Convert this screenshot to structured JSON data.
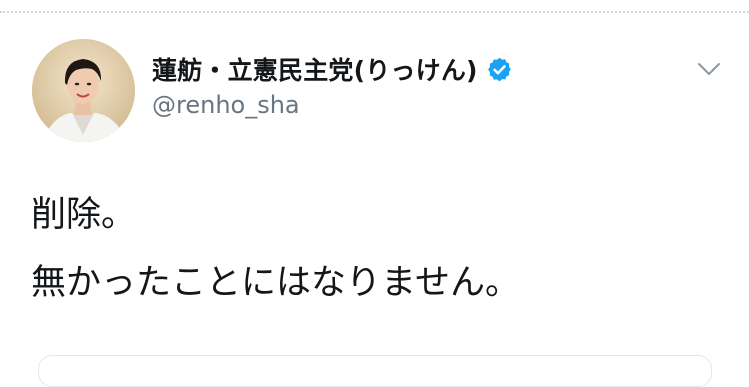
{
  "tweet": {
    "author": {
      "display_name": "蓮舫・立憲民主党(りっけん)",
      "handle": "@renho_sha",
      "verified": true
    },
    "text_lines": [
      "削除。",
      "無かったことにはなりません。"
    ]
  },
  "icons": {
    "verified": "verified-badge-icon",
    "menu": "chevron-down-icon"
  },
  "colors": {
    "verified": "#1da1f2",
    "text": "#14171a",
    "muted": "#687683"
  }
}
